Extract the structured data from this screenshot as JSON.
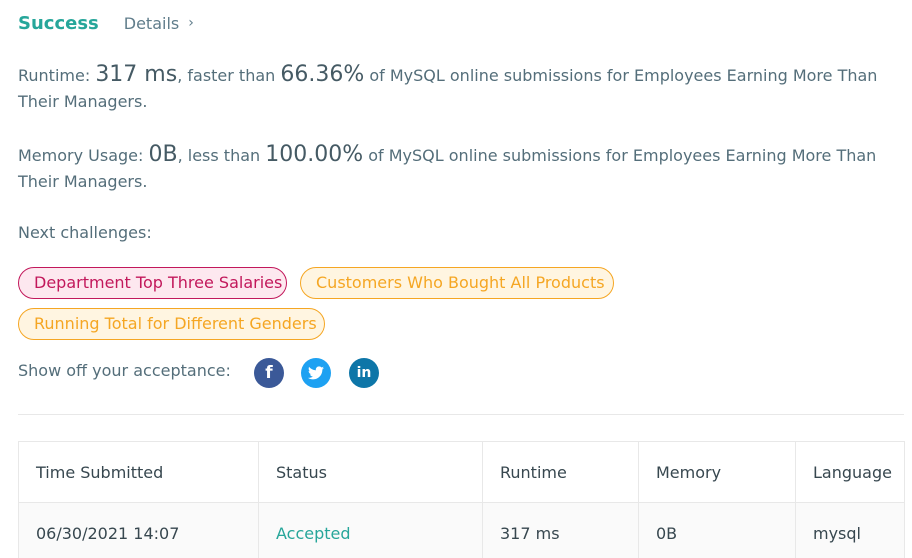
{
  "header": {
    "status": "Success",
    "details_label": "Details",
    "chevron": "›"
  },
  "runtime": {
    "label": "Runtime: ",
    "value": "317 ms",
    "mid": ", faster than ",
    "percent": "66.36%",
    "suffix": " of MySQL online submissions for Employees Earning More Than Their Managers."
  },
  "memory": {
    "label": "Memory Usage: ",
    "value": "0B",
    "mid": ", less than ",
    "percent": "100.00%",
    "suffix": " of MySQL online submissions for Employees Earning More Than Their Managers."
  },
  "next_challenges": {
    "label": "Next challenges:",
    "items": [
      {
        "label": "Department Top Three Salaries",
        "difficulty": "hard"
      },
      {
        "label": "Customers Who Bought All Products",
        "difficulty": "medium"
      },
      {
        "label": "Running Total for Different Genders",
        "difficulty": "medium"
      }
    ]
  },
  "share": {
    "label": "Show off your acceptance:",
    "icons": [
      "facebook-icon",
      "twitter-icon",
      "linkedin-icon"
    ],
    "facebook_glyph": "f",
    "linkedin_glyph": "in"
  },
  "table": {
    "headers": [
      "Time Submitted",
      "Status",
      "Runtime",
      "Memory",
      "Language"
    ],
    "rows": [
      [
        "06/30/2021 14:07",
        "Accepted",
        "317 ms",
        "0B",
        "mysql"
      ]
    ]
  },
  "colors": {
    "accent": "#26a69a",
    "hard": "#c2185b",
    "medium": "#f5a623",
    "facebook": "#3b5998",
    "twitter": "#1da1f2",
    "linkedin": "#0e76a8"
  }
}
